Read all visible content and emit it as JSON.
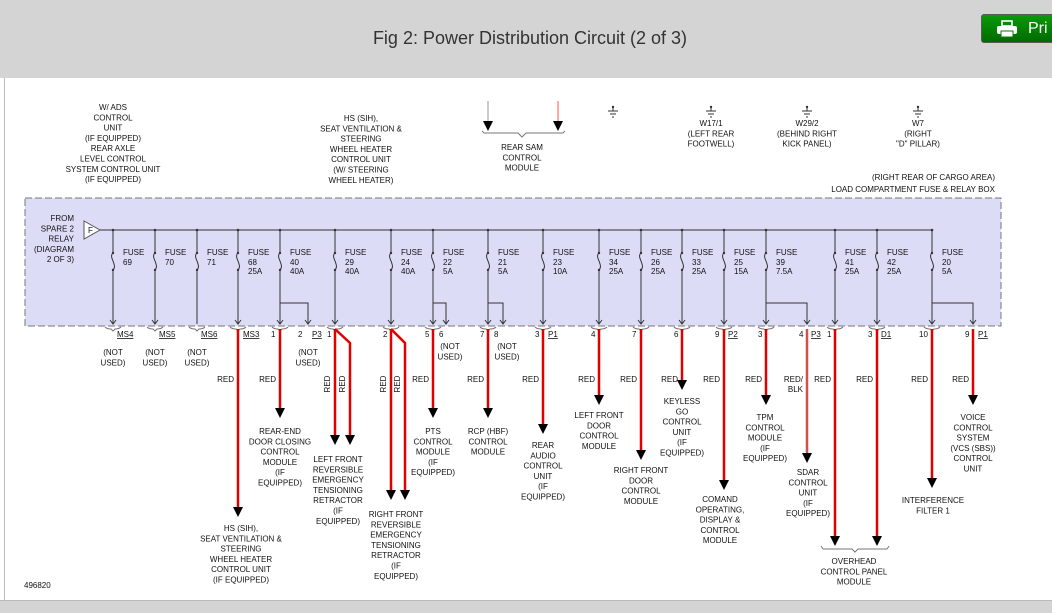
{
  "header": {
    "title": "Fig 2: Power Distribution Circuit (2 of 3)",
    "print_label": "Pri",
    "print_icon": "printer-icon"
  },
  "colors": {
    "wire": "#e00000",
    "box_fill": "#dcdcf7",
    "print_button": "#008000"
  },
  "diagram": {
    "figure_id": "496820",
    "box_title": [
      "(RIGHT REAR OF CARGO AREA)",
      "LOAD COMPARTMENT FUSE & RELAY BOX"
    ],
    "source": {
      "connector": "F",
      "lines": [
        "FROM",
        "SPARE 2",
        "RELAY",
        "(DIAGRAM",
        "2 OF 3)"
      ]
    },
    "top_labels": [
      {
        "lines": [
          "W/ ADS",
          "CONTROL",
          "UNIT",
          "(IF EQUIPPED)",
          "REAR AXLE",
          "LEVEL CONTROL",
          "SYSTEM CONTROL UNIT",
          "(IF EQUIPPED)"
        ]
      },
      {
        "lines": [
          "HS (SIH),",
          "SEAT VENTILATION &",
          "STEERING",
          "WHEEL HEATER",
          "CONTROL UNIT",
          "(W/ STEERING",
          "WHEEL HEATER)"
        ]
      },
      {
        "lines": [
          "REAR SAM",
          "CONTROL",
          "MODULE"
        ]
      }
    ],
    "grounds": [
      {
        "lines": []
      },
      {
        "lines": [
          "W17/1",
          "(LEFT REAR",
          "FOOTWELL)"
        ]
      },
      {
        "lines": [
          "W29/2",
          "(BEHIND RIGHT",
          "KICK PANEL)"
        ]
      },
      {
        "lines": [
          "W7",
          "(RIGHT",
          "\"D\" PILLAR)"
        ]
      }
    ],
    "fuse_label": "FUSE",
    "fuses": [
      {
        "number": "69",
        "amp": ""
      },
      {
        "number": "70",
        "amp": ""
      },
      {
        "number": "71",
        "amp": ""
      },
      {
        "number": "68",
        "amp": "25A"
      },
      {
        "number": "40",
        "amp": "40A"
      },
      {
        "number": "29",
        "amp": "40A"
      },
      {
        "number": "24",
        "amp": "40A"
      },
      {
        "number": "22",
        "amp": "5A"
      },
      {
        "number": "21",
        "amp": "5A"
      },
      {
        "number": "23",
        "amp": "10A"
      },
      {
        "number": "34",
        "amp": "25A"
      },
      {
        "number": "26",
        "amp": "25A"
      },
      {
        "number": "33",
        "amp": "25A"
      },
      {
        "number": "25",
        "amp": "15A"
      },
      {
        "number": "39",
        "amp": "7.5A"
      },
      {
        "number": "41",
        "amp": "25A"
      },
      {
        "number": "42",
        "amp": "25A"
      },
      {
        "number": "20",
        "amp": "5A"
      }
    ],
    "connectors": [
      "MS4",
      "MS5",
      "MS6",
      "MS3",
      "1",
      "2",
      "P3",
      "1",
      "2",
      "5",
      "6",
      "7",
      "8",
      "3",
      "P1",
      "4",
      "7",
      "6",
      "9",
      "P2",
      "3",
      "4",
      "P3",
      "1",
      "3",
      "D1",
      "10",
      "9",
      "P1"
    ],
    "not_used": [
      "(NOT",
      "USED)"
    ],
    "wires": [
      {
        "colors": [
          "RED"
        ],
        "destination": [
          "HS (SIH),",
          "SEAT VENTILATION &",
          "STEERING",
          "WHEEL HEATER",
          "CONTROL UNIT",
          "(IF EQUIPPED)"
        ]
      },
      {
        "colors": [
          "RED"
        ],
        "destination": [
          "REAR-END",
          "DOOR CLOSING",
          "CONTROL",
          "MODULE",
          "(IF",
          "EQUIPPED)"
        ]
      },
      {
        "colors": [
          "RED",
          "RED"
        ],
        "destination": [
          "LEFT FRONT",
          "REVERSIBLE",
          "EMERGENCY",
          "TENSIONING",
          "RETRACTOR",
          "(IF",
          "EQUIPPED)"
        ]
      },
      {
        "colors": [
          "RED",
          "RED"
        ],
        "destination": [
          "RIGHT FRONT",
          "REVERSIBLE",
          "EMERGENCY",
          "TENSIONING",
          "RETRACTOR",
          "(IF",
          "EQUIPPED)"
        ]
      },
      {
        "colors": [
          "RED"
        ],
        "destination": [
          "PTS",
          "CONTROL",
          "MODULE",
          "(IF",
          "EQUIPPED)"
        ]
      },
      {
        "colors": [
          "RED"
        ],
        "destination": [
          "RCP (HBF)",
          "CONTROL",
          "MODULE"
        ]
      },
      {
        "colors": [
          "RED"
        ],
        "destination": [
          "REAR",
          "AUDIO",
          "CONTROL",
          "UNIT",
          "(IF",
          "EQUIPPED)"
        ]
      },
      {
        "colors": [
          "RED"
        ],
        "destination": [
          "LEFT FRONT",
          "DOOR",
          "CONTROL",
          "MODULE"
        ]
      },
      {
        "colors": [
          "RED"
        ],
        "destination": [
          "RIGHT FRONT",
          "DOOR",
          "CONTROL",
          "MODULE"
        ]
      },
      {
        "colors": [
          "RED"
        ],
        "destination": [
          "KEYLESS",
          "GO",
          "CONTROL",
          "UNIT",
          "(IF",
          "EQUIPPED)"
        ]
      },
      {
        "colors": [
          "RED"
        ],
        "destination": [
          "COMAND",
          "OPERATING,",
          "DISPLAY &",
          "CONTROL",
          "MODULE"
        ]
      },
      {
        "colors": [
          "RED"
        ],
        "destination": [
          "TPM",
          "CONTROL",
          "MODULE",
          "(IF",
          "EQUIPPED)"
        ]
      },
      {
        "colors": [
          "RED/",
          "BLK"
        ],
        "destination": [
          "SDAR",
          "CONTROL",
          "UNIT",
          "(IF",
          "EQUIPPED)"
        ]
      },
      {
        "colors": [
          "RED",
          "RED"
        ],
        "destination": [
          "OVERHEAD",
          "CONTROL PANEL",
          "MODULE"
        ]
      },
      {
        "colors": [
          "RED"
        ],
        "destination": [
          "INTERFERENCE",
          "FILTER 1"
        ]
      },
      {
        "colors": [
          "RED"
        ],
        "destination": [
          "VOICE",
          "CONTROL",
          "SYSTEM",
          "(VCS (SBS))",
          "CONTROL",
          "UNIT"
        ]
      }
    ]
  }
}
